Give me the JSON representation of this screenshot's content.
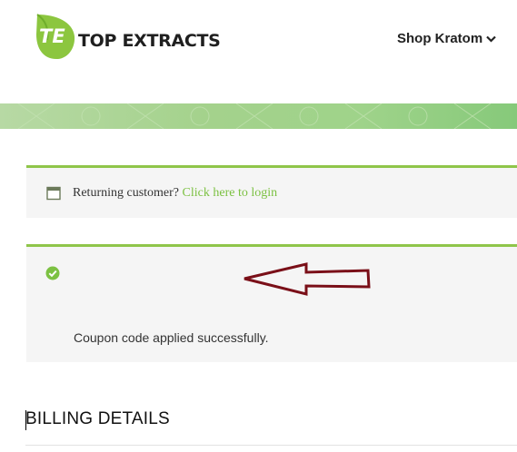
{
  "header": {
    "logo_mark": "TE",
    "logo_text": "TOP EXTRACTS",
    "nav": {
      "label": "Shop Kratom",
      "icon": "chevron-down-icon"
    }
  },
  "colors": {
    "accent_green": "#8fc54a",
    "link_green": "#7cc142",
    "notice_bg": "#f5f5f5",
    "arrow": "#7a0f18"
  },
  "notices": {
    "login": {
      "icon": "calendar-icon",
      "prefix": "Returning customer?",
      "link": "Click here to login"
    },
    "coupon": {
      "icon": "check-circle-icon",
      "message": "Coupon code applied successfully."
    }
  },
  "annotation": {
    "icon": "left-arrow-outline-icon"
  },
  "billing": {
    "heading": "BILLING DETAILS"
  }
}
